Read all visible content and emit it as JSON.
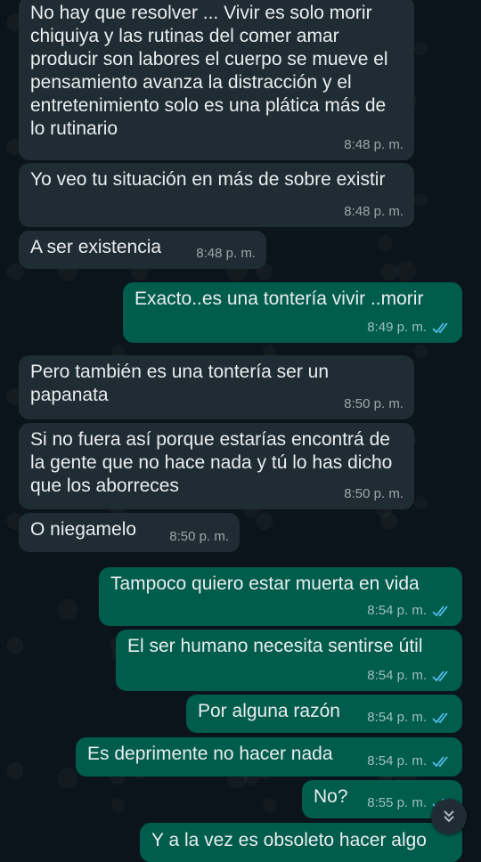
{
  "colors": {
    "background": "#0b141a",
    "incoming_bubble": "#202c33",
    "outgoing_bubble": "#005c4b",
    "read_ticks": "#53bdeb"
  },
  "messages": [
    {
      "dir": "in",
      "text": "No hay que resolver ... Vivir es solo morir chiquiya y las rutinas del comer amar producir son labores el cuerpo se mueve el pensamiento avanza la distracción y el entretenimiento solo es una plática más de lo rutinario",
      "time": "8:48 p. m."
    },
    {
      "dir": "in",
      "text": "Yo veo tu situación en más de sobre existir",
      "time": "8:48 p. m."
    },
    {
      "dir": "in",
      "text": "A ser existencia",
      "time": "8:48 p. m."
    },
    {
      "dir": "out",
      "text": "Exacto..es una tontería vivir ..morir",
      "time": "8:49 p. m.",
      "status": "read-double-check-icon"
    },
    {
      "dir": "in",
      "text": "Pero también es una tontería ser un papanata",
      "time": "8:50 p. m."
    },
    {
      "dir": "in",
      "text": "Si no fuera así porque estarías encontrá de la gente que no hace nada y tú lo has dicho que los aborreces",
      "time": "8:50 p. m."
    },
    {
      "dir": "in",
      "text": "O niegamelo",
      "time": "8:50 p. m."
    },
    {
      "dir": "out",
      "text": "Tampoco quiero estar muerta en vida",
      "time": "8:54 p. m.",
      "status": "read-double-check-icon"
    },
    {
      "dir": "out",
      "text": "El ser humano necesita sentirse útil",
      "time": "8:54 p. m.",
      "status": "read-double-check-icon"
    },
    {
      "dir": "out",
      "text": "Por alguna razón",
      "time": "8:54 p. m.",
      "status": "read-double-check-icon"
    },
    {
      "dir": "out",
      "text": "Es deprimente no hacer nada",
      "time": "8:54 p. m.",
      "status": "read-double-check-icon"
    },
    {
      "dir": "out",
      "text": "No?",
      "time": "8:55 p. m.",
      "status": "read-double-check-icon"
    },
    {
      "dir": "out",
      "text": "Y a la vez es obsoleto hacer algo",
      "time": ""
    }
  ],
  "scroll_button": {
    "icon": "double-chevron-down-icon"
  }
}
